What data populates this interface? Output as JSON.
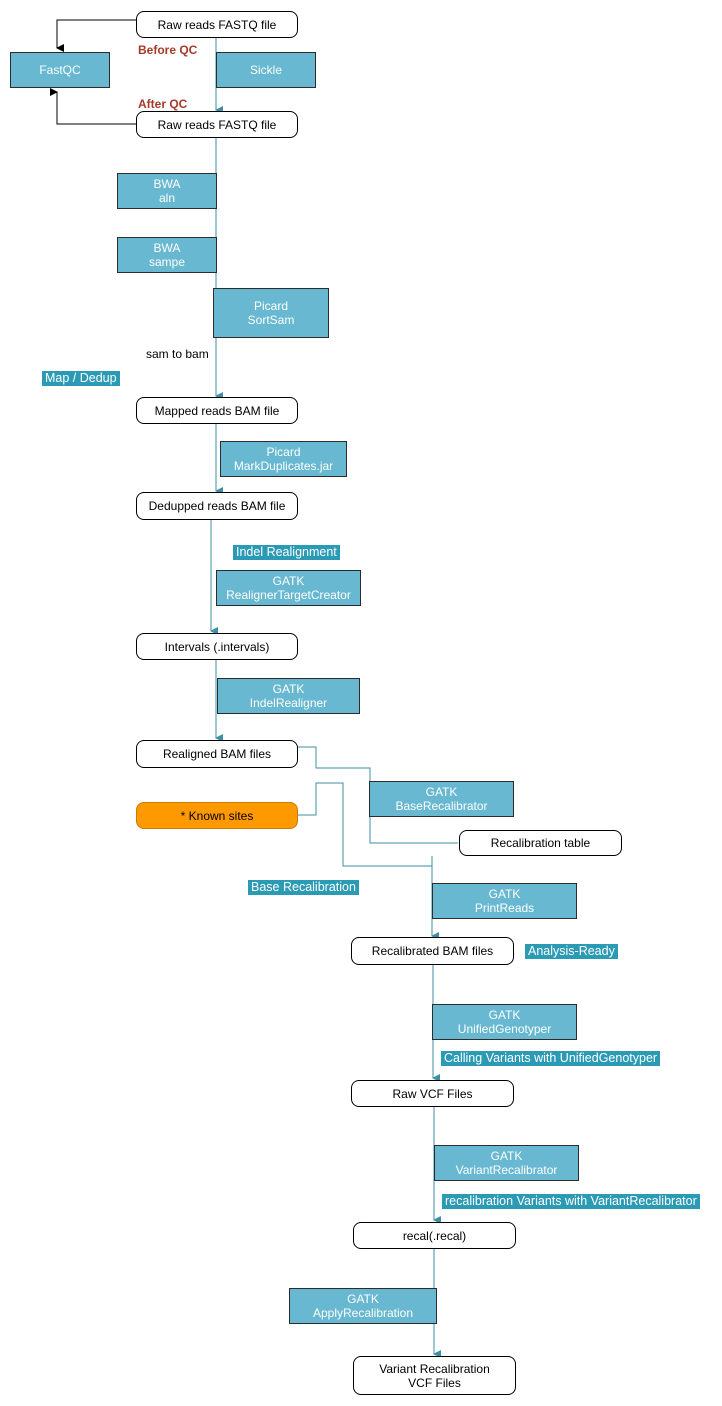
{
  "nodes": {
    "raw_fastq_1": "Raw reads FASTQ file",
    "raw_fastq_2": "Raw reads FASTQ file",
    "mapped_bam": "Mapped reads BAM file",
    "dedupped_bam": "Dedupped reads BAM file",
    "intervals": "Intervals (.intervals)",
    "realigned_bam": "Realigned BAM files",
    "known_sites": "* Known sites",
    "recal_table": "Recalibration table",
    "recalibrated_bam": "Recalibrated BAM files",
    "raw_vcf": "Raw VCF Files",
    "recal": "recal(.recal)",
    "variant_recal_vcf_1": "Variant Recalibration",
    "variant_recal_vcf_2": "VCF Files"
  },
  "tools": {
    "fastqc": [
      "FastQC"
    ],
    "sickle": [
      "Sickle"
    ],
    "bwa_aln": [
      "BWA",
      "aln"
    ],
    "bwa_sampe": [
      "BWA",
      "sampe"
    ],
    "picard_sortsam": [
      "Picard",
      "SortSam"
    ],
    "picard_markdup": [
      "Picard",
      "MarkDuplicates.jar"
    ],
    "gatk_rtc": [
      "GATK",
      "RealignerTargetCreator"
    ],
    "gatk_indelrealigner": [
      "GATK",
      "IndelRealigner"
    ],
    "gatk_baserecal": [
      "GATK",
      "BaseRecalibrator"
    ],
    "gatk_printreads": [
      "GATK",
      "PrintReads"
    ],
    "gatk_ug": [
      "GATK",
      "UnifiedGenotyper"
    ],
    "gatk_vr": [
      "GATK",
      "VariantRecalibrator"
    ],
    "gatk_apply": [
      "GATK",
      "ApplyRecalibration"
    ]
  },
  "labels": {
    "before_qc": "Before QC",
    "after_qc": "After QC",
    "sam_to_bam": "sam to bam",
    "map_dedup": "Map / Dedup",
    "indel_realignment": "Indel Realignment",
    "base_recalibration": "Base Recalibration",
    "analysis_ready": "Analysis-Ready",
    "calling_variants": "Calling Variants with UnifiedGenotyper",
    "recal_variants": "recalibration Variants with VariantRecalibrator"
  },
  "colors": {
    "tool_fill": "#67b8d0",
    "tag_fill": "#2b9ab5",
    "edge": "#3d8fa6",
    "known_sites_fill": "#ff9900",
    "qc_text": "#a33a2a"
  }
}
